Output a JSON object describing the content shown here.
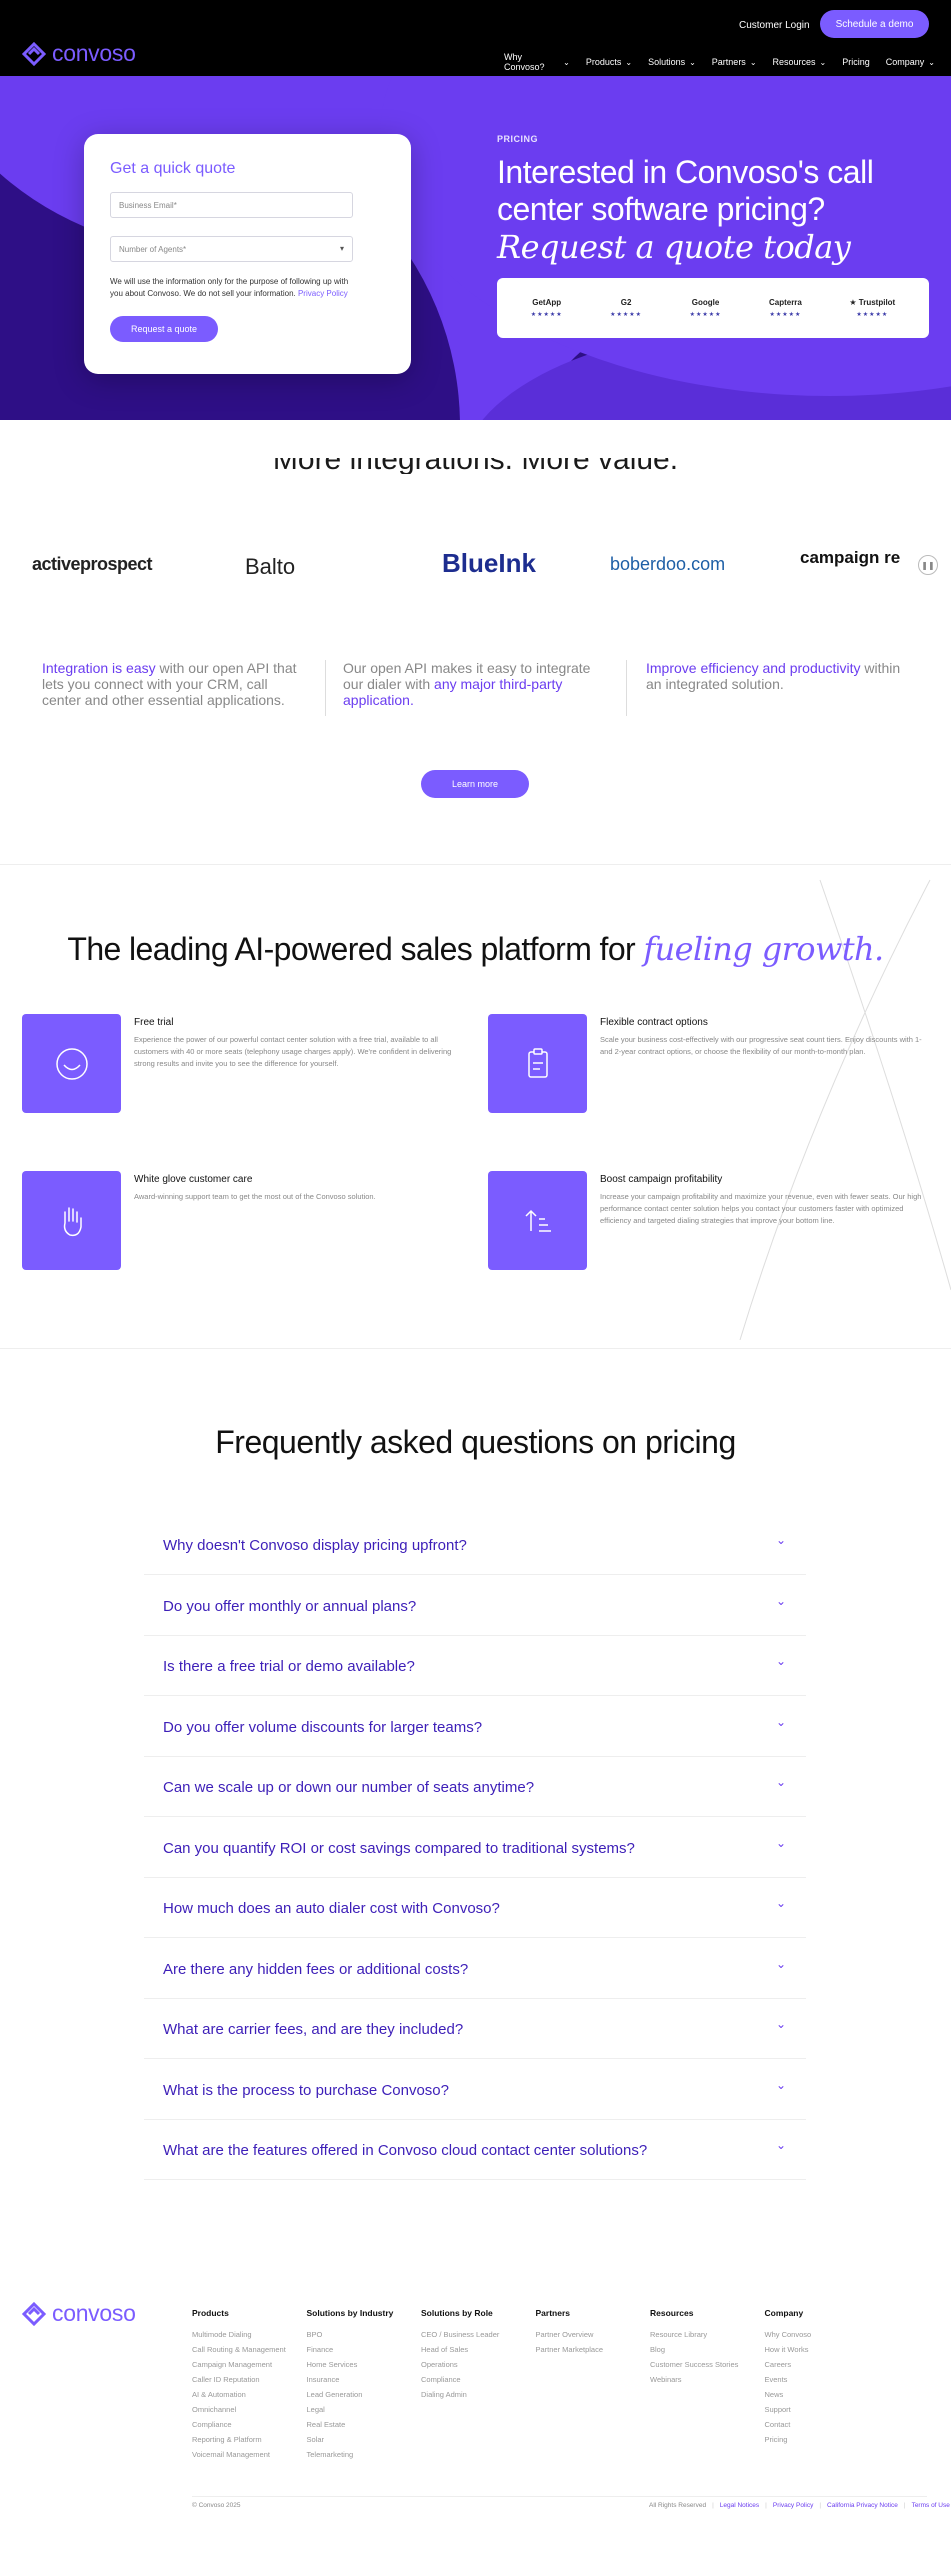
{
  "nav": {
    "logo_text": "convoso",
    "customer_login": "Customer Login",
    "schedule_demo": "Schedule a demo",
    "menu": [
      {
        "label": "Why Convoso?",
        "chev": true
      },
      {
        "label": "Products",
        "chev": true
      },
      {
        "label": "Solutions",
        "chev": true
      },
      {
        "label": "Partners",
        "chev": true
      },
      {
        "label": "Resources",
        "chev": true
      },
      {
        "label": "Pricing",
        "chev": false
      },
      {
        "label": "Company",
        "chev": true
      }
    ]
  },
  "hero": {
    "form_title": "Get a quick quote",
    "email_placeholder": "Business Email*",
    "agents_placeholder": "Number of Agents*",
    "notice": "We will use the information only for the purpose of following up with you about Convoso. We do not sell your information.",
    "privacy_link": "Privacy Policy",
    "request_button": "Request a quote",
    "pricing_tag": "PRICING",
    "title": "Interested in Convoso's call center software pricing?",
    "subtitle": "Request a quote today",
    "reviews": [
      {
        "name": "GetApp",
        "stars": "★★★★★"
      },
      {
        "name": "G2",
        "stars": "★★★★★"
      },
      {
        "name": "Google",
        "stars": "★★★★★"
      },
      {
        "name": "Capterra",
        "stars": "★★★★★"
      },
      {
        "name": "★ Trustpilot",
        "stars": "★★★★★"
      }
    ]
  },
  "integrations": {
    "heading": "More integrations. More value.",
    "partners": [
      "activeprospect",
      "Balto",
      "BlueInk",
      "boberdoo.com",
      "campaign re"
    ],
    "features": [
      {
        "highlight": "Integration is easy",
        "rest": " with our open API that lets you connect with your CRM, call center and other essential applications."
      },
      {
        "pre": "Our open API makes it easy to integrate our dialer with ",
        "highlight": "any major third-party application."
      },
      {
        "highlight": "Improve efficiency and productivity",
        "rest": " within an integrated solution."
      }
    ],
    "learn_more": "Learn more"
  },
  "leading": {
    "title": "The leading AI-powered sales platform for ",
    "title_em": "fueling growth.",
    "cards": [
      {
        "title": "Free trial",
        "desc": "Experience the power of our powerful contact center solution with a free trial, available to all customers with 40 or more seats (telephony usage charges apply). We're confident in delivering strong results and invite you to see the difference for yourself.",
        "icon": "smile-icon"
      },
      {
        "title": "Flexible contract options",
        "desc": "Scale your business cost-effectively with our progressive seat count tiers. Enjoy discounts with 1- and 2-year contract options, or choose the flexibility of our month-to-month plan.",
        "icon": "clipboard-icon"
      },
      {
        "title": "White glove customer care",
        "desc": "Award-winning support team to get the most out of the Convoso solution.",
        "icon": "hand-icon"
      },
      {
        "title": "Boost campaign profitability",
        "desc": "Increase your campaign profitability and maximize your revenue, even with fewer seats. Our high performance contact center solution helps you contact your customers faster with optimized efficiency and targeted dialing strategies that improve your bottom line.",
        "icon": "sort-up-icon"
      }
    ]
  },
  "faq": {
    "title": "Frequently asked questions on pricing",
    "items": [
      "Why doesn't Convoso display pricing upfront?",
      "Do you offer monthly or annual plans?",
      "Is there a free trial or demo available?",
      "Do you offer volume discounts for larger teams?",
      "Can we scale up or down our number of seats anytime?",
      "Can you quantify ROI or cost savings compared to traditional systems?",
      "How much does an auto dialer cost with Convoso?",
      "Are there any hidden fees or additional costs?",
      "What are carrier fees, and are they included?",
      "What is the process to purchase Convoso?",
      "What are the features offered in Convoso cloud contact center solutions?"
    ]
  },
  "footer": {
    "logo_text": "convoso",
    "columns": [
      {
        "heading": "Products",
        "items": [
          "Multimode Dialing",
          "Call Routing & Management",
          "Campaign Management",
          "Caller ID Reputation",
          "AI & Automation",
          "Omnichannel",
          "Compliance",
          "Reporting & Platform",
          "Voicemail Management"
        ]
      },
      {
        "heading": "Solutions by Industry",
        "items": [
          "BPO",
          "Finance",
          "Home Services",
          "Insurance",
          "Lead Generation",
          "Legal",
          "Real Estate",
          "Solar",
          "Telemarketing"
        ]
      },
      {
        "heading": "Solutions by Role",
        "items": [
          "CEO / Business Leader",
          "Head of Sales",
          "Operations",
          "Compliance",
          "Dialing Admin"
        ]
      },
      {
        "heading": "Partners",
        "items": [
          "Partner Overview",
          "Partner Marketplace"
        ]
      },
      {
        "heading": "Resources",
        "items": [
          "Resource Library",
          "Blog",
          "Customer Success Stories",
          "Webinars"
        ]
      },
      {
        "heading": "Company",
        "items": [
          "Why Convoso",
          "How it Works",
          "Careers",
          "Events",
          "News",
          "Support",
          "Contact",
          "Pricing"
        ]
      }
    ],
    "copyright": "© Convoso 2025",
    "legal": [
      "All Rights Reserved",
      "Legal Notices",
      "Privacy Policy",
      "California Privacy Notice",
      "Terms of Use"
    ]
  }
}
